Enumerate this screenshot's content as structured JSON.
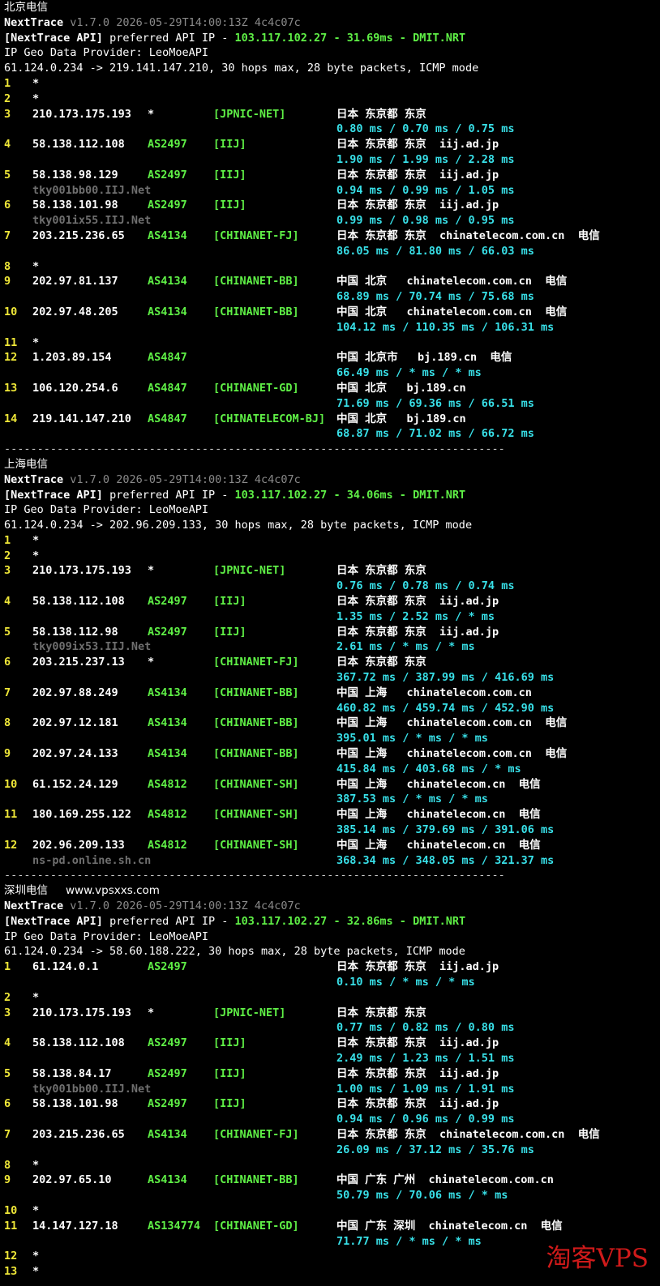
{
  "watermark": "淘客VPS",
  "sections": [
    {
      "title": "北京电信",
      "url": "",
      "nt_name": "NextTrace",
      "nt_ver": "v1.7.0 2026-05-29T14:00:13Z 4c4c07c",
      "api_prefix": "[NextTrace API]",
      "api_mid": "preferred API IP -",
      "api_ip": "103.117.102.27",
      "api_dash1": "-",
      "api_ms": "31.69ms",
      "api_dash2": "-",
      "api_node": "DMIT.NRT",
      "geo_provider": "IP Geo Data Provider: LeoMoeAPI",
      "route": "61.124.0.234 -> 219.141.147.210, 30 hops max, 28 byte packets, ICMP mode",
      "hops": [
        {
          "n": "1",
          "ip": "*"
        },
        {
          "n": "2",
          "ip": "*"
        },
        {
          "n": "3",
          "ip": "210.173.175.193",
          "as": "*",
          "net": "[JPNIC-NET]",
          "geo": "日本 东京都 东京",
          "rtt": "0.80 ms / 0.70 ms / 0.75 ms"
        },
        {
          "n": "4",
          "ip": "58.138.112.108",
          "as": "AS2497",
          "net": "[IIJ]",
          "geo": "日本 东京都 东京  iij.ad.jp",
          "rtt": "1.90 ms / 1.99 ms / 2.28 ms"
        },
        {
          "n": "5",
          "ip": "58.138.98.129",
          "as": "AS2497",
          "net": "[IIJ]",
          "geo": "日本 东京都 东京  iij.ad.jp",
          "host": "tky001bb00.IIJ.Net",
          "rtt": "0.94 ms / 0.99 ms / 1.05 ms"
        },
        {
          "n": "6",
          "ip": "58.138.101.98",
          "as": "AS2497",
          "net": "[IIJ]",
          "geo": "日本 东京都 东京  iij.ad.jp",
          "host": "tky001ix55.IIJ.Net",
          "rtt": "0.99 ms / 0.98 ms / 0.95 ms"
        },
        {
          "n": "7",
          "ip": "203.215.236.65",
          "as": "AS4134",
          "net": "[CHINANET-FJ]",
          "geo": "日本 东京都 东京  chinatelecom.com.cn  电信",
          "rtt": "86.05 ms / 81.80 ms / 66.03 ms"
        },
        {
          "n": "8",
          "ip": "*"
        },
        {
          "n": "9",
          "ip": "202.97.81.137",
          "as": "AS4134",
          "net": "[CHINANET-BB]",
          "geo": "中国 北京   chinatelecom.com.cn  电信",
          "rtt": "68.89 ms / 70.74 ms / 75.68 ms"
        },
        {
          "n": "10",
          "ip": "202.97.48.205",
          "as": "AS4134",
          "net": "[CHINANET-BB]",
          "geo": "中国 北京   chinatelecom.com.cn  电信",
          "rtt": "104.12 ms / 110.35 ms / 106.31 ms"
        },
        {
          "n": "11",
          "ip": "*"
        },
        {
          "n": "12",
          "ip": "1.203.89.154",
          "as": "AS4847",
          "net": "",
          "geo": "中国 北京市   bj.189.cn  电信",
          "rtt": "66.49 ms / * ms / * ms"
        },
        {
          "n": "13",
          "ip": "106.120.254.6",
          "as": "AS4847",
          "net": "[CHINANET-GD]",
          "geo": "中国 北京   bj.189.cn",
          "rtt": "71.69 ms / 69.36 ms / 66.51 ms"
        },
        {
          "n": "14",
          "ip": "219.141.147.210",
          "as": "AS4847",
          "net": "[CHINATELECOM-BJ]",
          "geo": "中国 北京   bj.189.cn",
          "rtt": "68.87 ms / 71.02 ms / 66.72 ms"
        }
      ],
      "separator": "----------------------------------------------------------------------------"
    },
    {
      "title": "上海电信",
      "url": "",
      "nt_name": "NextTrace",
      "nt_ver": "v1.7.0 2026-05-29T14:00:13Z 4c4c07c",
      "api_prefix": "[NextTrace API]",
      "api_mid": "preferred API IP -",
      "api_ip": "103.117.102.27",
      "api_dash1": "-",
      "api_ms": "34.06ms",
      "api_dash2": "-",
      "api_node": "DMIT.NRT",
      "geo_provider": "IP Geo Data Provider: LeoMoeAPI",
      "route": "61.124.0.234 -> 202.96.209.133, 30 hops max, 28 byte packets, ICMP mode",
      "hops": [
        {
          "n": "1",
          "ip": "*"
        },
        {
          "n": "2",
          "ip": "*"
        },
        {
          "n": "3",
          "ip": "210.173.175.193",
          "as": "*",
          "net": "[JPNIC-NET]",
          "geo": "日本 东京都 东京",
          "rtt": "0.76 ms / 0.78 ms / 0.74 ms"
        },
        {
          "n": "4",
          "ip": "58.138.112.108",
          "as": "AS2497",
          "net": "[IIJ]",
          "geo": "日本 东京都 东京  iij.ad.jp",
          "rtt": "1.35 ms / 2.52 ms / * ms"
        },
        {
          "n": "5",
          "ip": "58.138.112.98",
          "as": "AS2497",
          "net": "[IIJ]",
          "geo": "日本 东京都 东京  iij.ad.jp",
          "host": "tky009ix53.IIJ.Net",
          "rtt": "2.61 ms / * ms / * ms"
        },
        {
          "n": "6",
          "ip": "203.215.237.13",
          "as": "*",
          "net": "[CHINANET-FJ]",
          "geo": "日本 东京都 东京",
          "rtt": "367.72 ms / 387.99 ms / 416.69 ms"
        },
        {
          "n": "7",
          "ip": "202.97.88.249",
          "as": "AS4134",
          "net": "[CHINANET-BB]",
          "geo": "中国 上海   chinatelecom.com.cn",
          "rtt": "460.82 ms / 459.74 ms / 452.90 ms"
        },
        {
          "n": "8",
          "ip": "202.97.12.181",
          "as": "AS4134",
          "net": "[CHINANET-BB]",
          "geo": "中国 上海   chinatelecom.com.cn  电信",
          "rtt": "395.01 ms / * ms / * ms"
        },
        {
          "n": "9",
          "ip": "202.97.24.133",
          "as": "AS4134",
          "net": "[CHINANET-BB]",
          "geo": "中国 上海   chinatelecom.com.cn  电信",
          "rtt": "415.84 ms / 403.68 ms / * ms"
        },
        {
          "n": "10",
          "ip": "61.152.24.129",
          "as": "AS4812",
          "net": "[CHINANET-SH]",
          "geo": "中国 上海   chinatelecom.cn  电信",
          "rtt": "387.53 ms / * ms / * ms"
        },
        {
          "n": "11",
          "ip": "180.169.255.122",
          "as": "AS4812",
          "net": "[CHINANET-SH]",
          "geo": "中国 上海   chinatelecom.cn  电信",
          "rtt": "385.14 ms / 379.69 ms / 391.06 ms"
        },
        {
          "n": "12",
          "ip": "202.96.209.133",
          "as": "AS4812",
          "net": "[CHINANET-SH]",
          "geo": "中国 上海   chinatelecom.cn  电信",
          "host": "ns-pd.online.sh.cn",
          "rtt": "368.34 ms / 348.05 ms / 321.37 ms"
        }
      ],
      "separator": "----------------------------------------------------------------------------"
    },
    {
      "title": "深圳电信",
      "url": "www.vpsxxs.com",
      "nt_name": "NextTrace",
      "nt_ver": "v1.7.0 2026-05-29T14:00:13Z 4c4c07c",
      "api_prefix": "[NextTrace API]",
      "api_mid": "preferred API IP -",
      "api_ip": "103.117.102.27",
      "api_dash1": "-",
      "api_ms": "32.86ms",
      "api_dash2": "-",
      "api_node": "DMIT.NRT",
      "geo_provider": "IP Geo Data Provider: LeoMoeAPI",
      "route": "61.124.0.234 -> 58.60.188.222, 30 hops max, 28 byte packets, ICMP mode",
      "hops": [
        {
          "n": "1",
          "ip": "61.124.0.1",
          "as": "AS2497",
          "net": "",
          "geo": "日本 东京都 东京  iij.ad.jp",
          "rtt": "0.10 ms / * ms / * ms"
        },
        {
          "n": "2",
          "ip": "*"
        },
        {
          "n": "3",
          "ip": "210.173.175.193",
          "as": "*",
          "net": "[JPNIC-NET]",
          "geo": "日本 东京都 东京",
          "rtt": "0.77 ms / 0.82 ms / 0.80 ms"
        },
        {
          "n": "4",
          "ip": "58.138.112.108",
          "as": "AS2497",
          "net": "[IIJ]",
          "geo": "日本 东京都 东京  iij.ad.jp",
          "rtt": "2.49 ms / 1.23 ms / 1.51 ms"
        },
        {
          "n": "5",
          "ip": "58.138.84.17",
          "as": "AS2497",
          "net": "[IIJ]",
          "geo": "日本 东京都 东京  iij.ad.jp",
          "host": "tky001bb00.IIJ.Net",
          "rtt": "1.00 ms / 1.09 ms / 1.91 ms"
        },
        {
          "n": "6",
          "ip": "58.138.101.98",
          "as": "AS2497",
          "net": "[IIJ]",
          "geo": "日本 东京都 东京  iij.ad.jp",
          "rtt": "0.94 ms / 0.96 ms / 0.99 ms"
        },
        {
          "n": "7",
          "ip": "203.215.236.65",
          "as": "AS4134",
          "net": "[CHINANET-FJ]",
          "geo": "日本 东京都 东京  chinatelecom.com.cn  电信",
          "rtt": "26.09 ms / 37.12 ms / 35.76 ms"
        },
        {
          "n": "8",
          "ip": "*"
        },
        {
          "n": "9",
          "ip": "202.97.65.10",
          "as": "AS4134",
          "net": "[CHINANET-BB]",
          "geo": "中国 广东 广州  chinatelecom.com.cn",
          "rtt": "50.79 ms / 70.06 ms / * ms"
        },
        {
          "n": "10",
          "ip": "*"
        },
        {
          "n": "11",
          "ip": "14.147.127.18",
          "as": "AS134774",
          "net": "[CHINANET-GD]",
          "geo": "中国 广东 深圳  chinatelecom.cn  电信",
          "rtt": "71.77 ms / * ms / * ms"
        },
        {
          "n": "12",
          "ip": "*"
        },
        {
          "n": "13",
          "ip": "*"
        }
      ],
      "separator": ""
    }
  ]
}
